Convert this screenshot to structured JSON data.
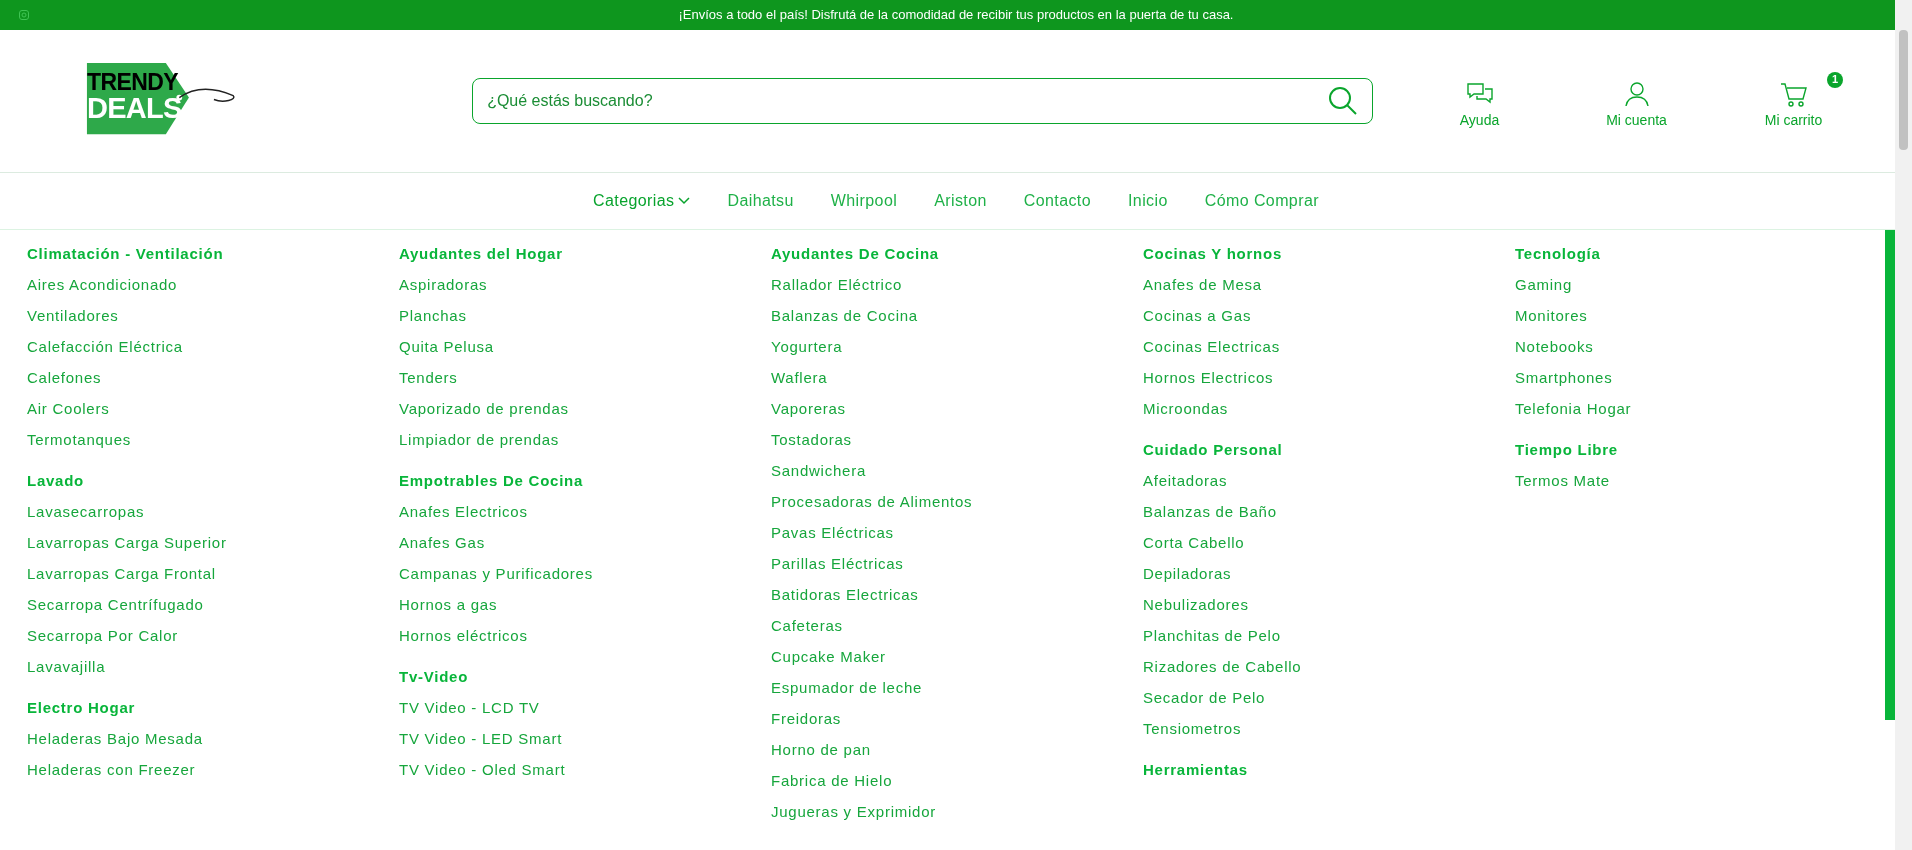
{
  "announcement": {
    "text": "¡Envíos a todo el país! Disfrutá de la comodidad de recibir tus productos en la puerta de tu casa."
  },
  "logo": {
    "line_1": "TRENDY",
    "line_2": "DEALS"
  },
  "search": {
    "placeholder": "¿Qué estás buscando?"
  },
  "header_actions": [
    {
      "kind": "help",
      "label": "Ayuda"
    },
    {
      "kind": "account",
      "label": "Mi cuenta"
    },
    {
      "kind": "cart",
      "label": "Mi carrito",
      "badge": "1"
    }
  ],
  "nav": [
    {
      "label": "Categorias",
      "expanded": true
    },
    {
      "label": "Daihatsu"
    },
    {
      "label": "Whirpool"
    },
    {
      "label": "Ariston"
    },
    {
      "label": "Contacto"
    },
    {
      "label": "Inicio"
    },
    {
      "label": "Cómo Comprar"
    }
  ],
  "mega_menu": [
    {
      "groups": [
        {
          "title": "Climatación - Ventilación",
          "items": [
            "Aires Acondicionado",
            "Ventiladores",
            "Calefacción Eléctrica",
            "Calefones",
            "Air Coolers",
            "Termotanques"
          ]
        },
        {
          "title": "Lavado",
          "items": [
            "Lavasecarropas",
            "Lavarropas Carga Superior",
            "Lavarropas Carga Frontal",
            "Secarropa Centrífugado",
            "Secarropa Por Calor",
            "Lavavajilla"
          ]
        },
        {
          "title": "Electro Hogar",
          "items": [
            "Heladeras Bajo Mesada",
            "Heladeras con Freezer"
          ]
        }
      ]
    },
    {
      "groups": [
        {
          "title": "Ayudantes del Hogar",
          "items": [
            "Aspiradoras",
            "Planchas",
            "Quita Pelusa",
            "Tenders",
            "Vaporizado de prendas",
            "Limpiador de prendas"
          ]
        },
        {
          "title": "Empotrables De Cocina",
          "items": [
            "Anafes Electricos",
            "Anafes Gas",
            "Campanas y Purificadores",
            "Hornos a gas",
            "Hornos eléctricos"
          ]
        },
        {
          "title": "Tv-Video",
          "items": [
            "TV Video - LCD TV",
            "TV Video - LED Smart",
            "TV Video - Oled Smart"
          ]
        }
      ]
    },
    {
      "groups": [
        {
          "title": "Ayudantes De Cocina",
          "items": [
            "Rallador Eléctrico",
            "Balanzas de Cocina",
            "Yogurtera",
            "Waflera",
            "Vaporeras",
            "Tostadoras",
            "Sandwichera",
            "Procesadoras de Alimentos",
            "Pavas Eléctricas",
            "Parillas Eléctricas",
            "Batidoras Electricas",
            "Cafeteras",
            "Cupcake Maker",
            "Espumador de leche",
            "Freidoras",
            "Horno de pan",
            "Fabrica de Hielo",
            "Jugueras y Exprimidor"
          ]
        }
      ]
    },
    {
      "groups": [
        {
          "title": "Cocinas Y hornos",
          "items": [
            "Anafes de Mesa",
            "Cocinas a Gas",
            "Cocinas Electricas",
            "Hornos Electricos",
            "Microondas"
          ]
        },
        {
          "title": "Cuidado Personal",
          "items": [
            "Afeitadoras",
            "Balanzas de Baño",
            "Corta Cabello",
            "Depiladoras",
            "Nebulizadores",
            "Planchitas de Pelo",
            "Rizadores de Cabello",
            "Secador de Pelo",
            "Tensiometros"
          ]
        },
        {
          "title": "Herramientas"
        }
      ]
    },
    {
      "groups": [
        {
          "title": "Tecnología",
          "items": [
            "Gaming",
            "Monitores",
            "Notebooks",
            "Smartphones",
            "Telefonia Hogar"
          ]
        },
        {
          "title": "Tiempo Libre",
          "items": [
            "Termos Mate"
          ]
        }
      ]
    }
  ]
}
